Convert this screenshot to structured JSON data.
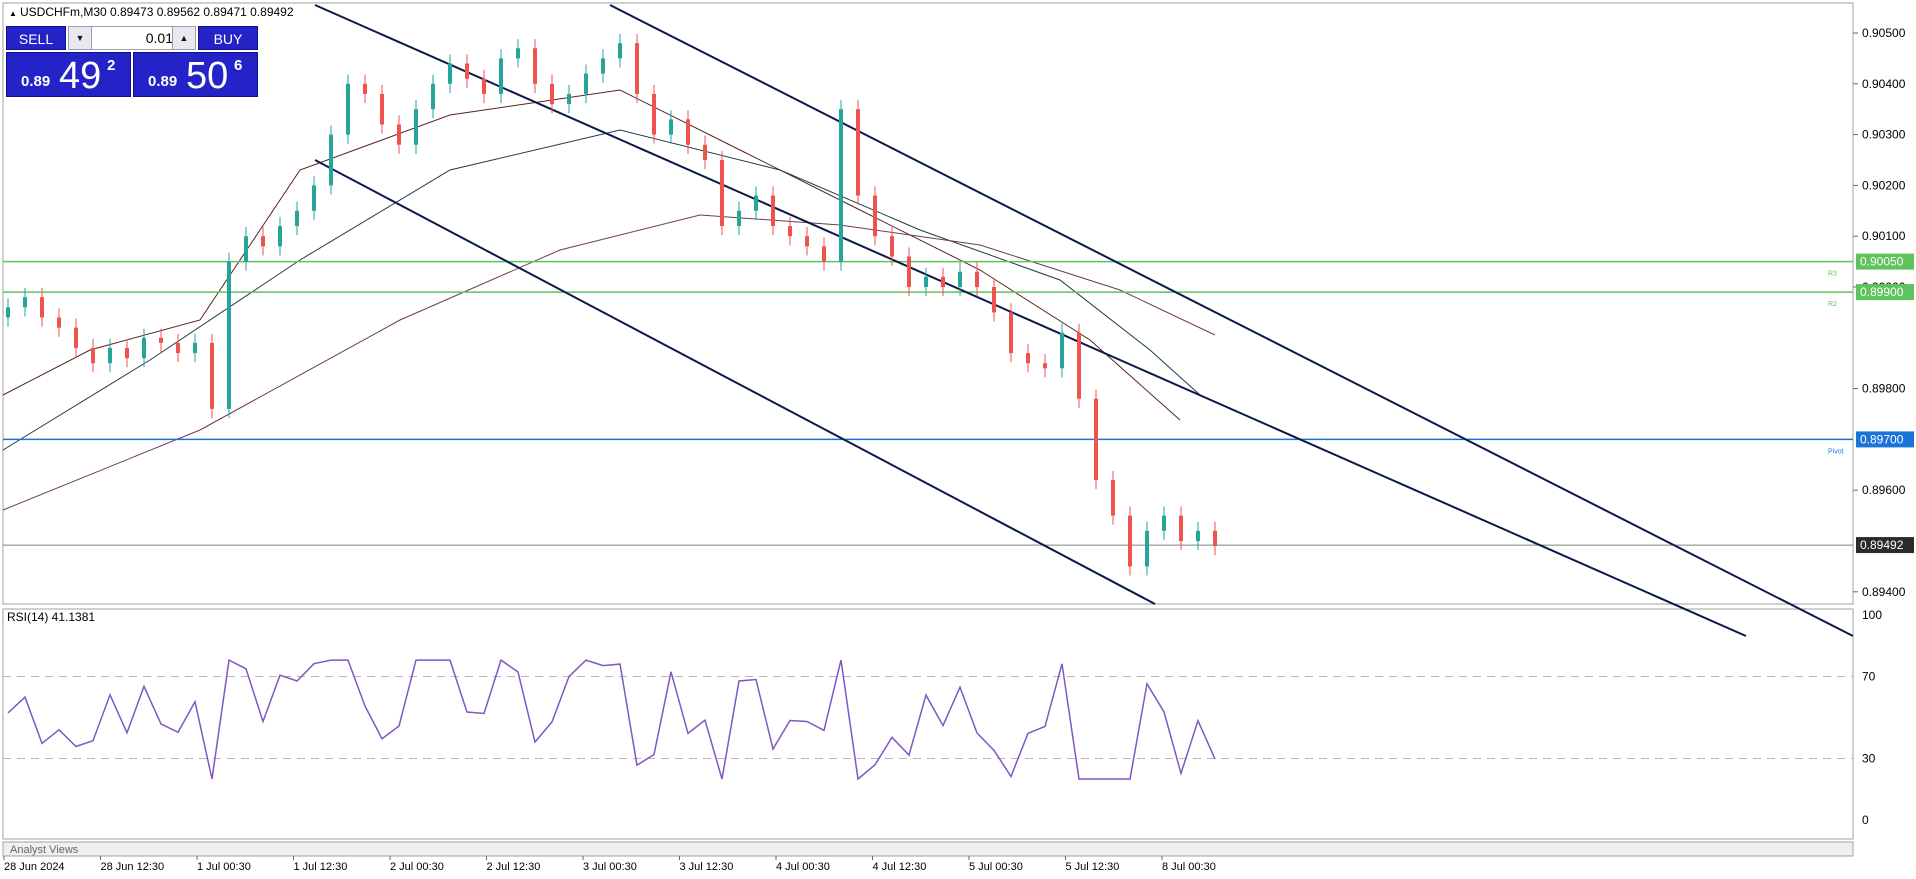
{
  "header": {
    "symbol": "USDCHFm,M30",
    "ohlc": "0.89473 0.89562 0.89471 0.89492"
  },
  "trade_panel": {
    "sell_label": "SELL",
    "buy_label": "BUY",
    "lot": "0.01",
    "bid": {
      "prefix": "0.89",
      "big": "49",
      "sup": "2"
    },
    "ask": {
      "prefix": "0.89",
      "big": "50",
      "sup": "6"
    }
  },
  "price_axis": {
    "labels": [
      "0.90500",
      "0.90400",
      "0.90300",
      "0.90200",
      "0.90100",
      "0.90000",
      "0.89800",
      "0.89600",
      "0.89400"
    ],
    "values": [
      0.905,
      0.904,
      0.903,
      0.902,
      0.901,
      0.9,
      0.898,
      0.896,
      0.894
    ]
  },
  "levels": [
    {
      "name": "R3",
      "price": 0.9005,
      "label": "0.90050",
      "color": "#5ec25e"
    },
    {
      "name": "R2",
      "price": 0.8999,
      "label": "0.89900",
      "color": "#5ec25e"
    },
    {
      "name": "Pivot",
      "price": 0.897,
      "label": "0.89700",
      "color": "#1a73d9"
    }
  ],
  "current_price": {
    "price": 0.89492,
    "label": "0.89492"
  },
  "rsi": {
    "title": "RSI(14) 41.1381",
    "axis_labels": [
      "100",
      "70",
      "30",
      "0"
    ],
    "levels": [
      70,
      30
    ]
  },
  "time_axis": {
    "labels": [
      "28 Jun 2024",
      "28 Jun 12:30",
      "1 Jul 00:30",
      "1 Jul 12:30",
      "2 Jul 00:30",
      "2 Jul 12:30",
      "3 Jul 00:30",
      "3 Jul 12:30",
      "4 Jul 00:30",
      "4 Jul 12:30",
      "5 Jul 00:30",
      "5 Jul 12:30",
      "8 Jul 00:30"
    ]
  },
  "bottom_panel": {
    "label": "Analyst Views"
  },
  "colors": {
    "bull": "#26a69a",
    "bear": "#ef5350",
    "channel": "#0b1a4a",
    "rsi_line": "#7e57c2"
  },
  "chart_data": {
    "type": "candlestick",
    "series": [
      {
        "name": "USDCHFm,M30",
        "values": [
          0.8996,
          0.8998,
          0.8994,
          0.8992,
          0.8988,
          0.8985,
          0.8988,
          0.8986,
          0.899,
          0.8989,
          0.8987,
          0.8989,
          0.8976,
          0.9005,
          0.901,
          0.9008,
          0.9012,
          0.9015,
          0.902,
          0.903,
          0.904,
          0.9038,
          0.9032,
          0.9028,
          0.9035,
          0.904,
          0.9044,
          0.9041,
          0.9038,
          0.9045,
          0.9047,
          0.904,
          0.9036,
          0.9038,
          0.9042,
          0.9045,
          0.9048,
          0.9038,
          0.903,
          0.9033,
          0.9028,
          0.9025,
          0.9012,
          0.9015,
          0.9018,
          0.9012,
          0.901,
          0.9008,
          0.9005,
          0.9035,
          0.9018,
          0.901,
          0.9006,
          0.9,
          0.9002,
          0.9,
          0.9003,
          0.9,
          0.8995,
          0.8987,
          0.8985,
          0.8984,
          0.8991,
          0.8978,
          0.8962,
          0.8955,
          0.8945,
          0.8952,
          0.8955,
          0.895,
          0.8952,
          0.8949
        ]
      }
    ]
  }
}
